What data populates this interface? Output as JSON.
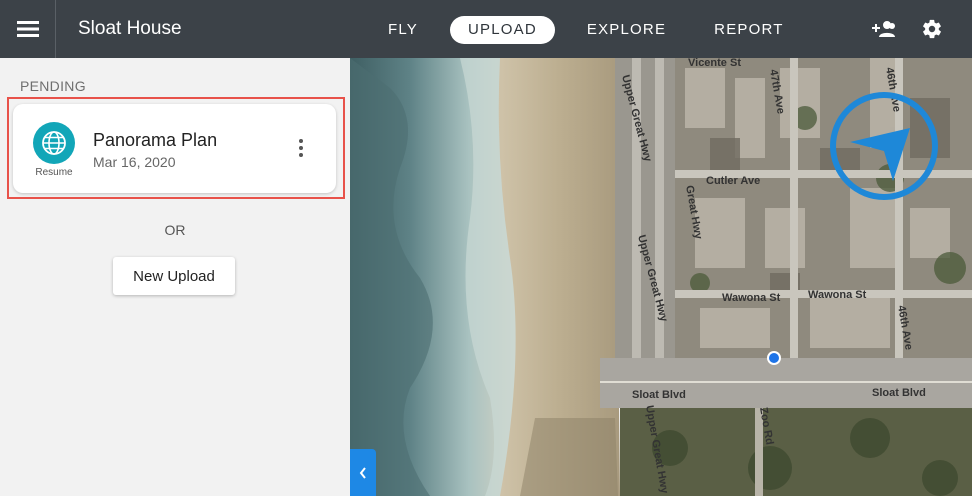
{
  "app": {
    "title": "Sloat House"
  },
  "nav": {
    "tabs": [
      {
        "label": "FLY"
      },
      {
        "label": "UPLOAD",
        "active": true
      },
      {
        "label": "EXPLORE"
      },
      {
        "label": "REPORT"
      }
    ]
  },
  "header_icons": [
    "menu-icon",
    "add-user-icon",
    "gear-icon"
  ],
  "sidebar": {
    "section_label": "PENDING",
    "pending_item": {
      "title": "Panorama Plan",
      "date": "Mar 16, 2020",
      "action_label": "Resume",
      "icon": "globe-icon"
    },
    "or_label": "OR",
    "new_upload_label": "New Upload"
  },
  "map": {
    "labels": {
      "upper_great_hwy_1": "Upper Great Hwy",
      "upper_great_hwy_2": "Upper Great Hwy",
      "upper_great_hwy_ext": "Upper Great Hwy Ext",
      "great_hwy": "Great Hwy",
      "cutler_ave": "Cutler Ave",
      "wawona_st_1": "Wawona St",
      "wawona_st_2": "Wawona St",
      "sloat_blvd_1": "Sloat Blvd",
      "sloat_blvd_2": "Sloat Blvd",
      "zoo_rd": "Zoo Rd",
      "ave_47th": "47th Ave",
      "ave_46th_1": "46th Ave",
      "ave_46th_2": "46th Ave",
      "vicente_st": "Vicente St"
    },
    "highlight_color": "#e8524a",
    "accent_color": "#1e88e5"
  }
}
